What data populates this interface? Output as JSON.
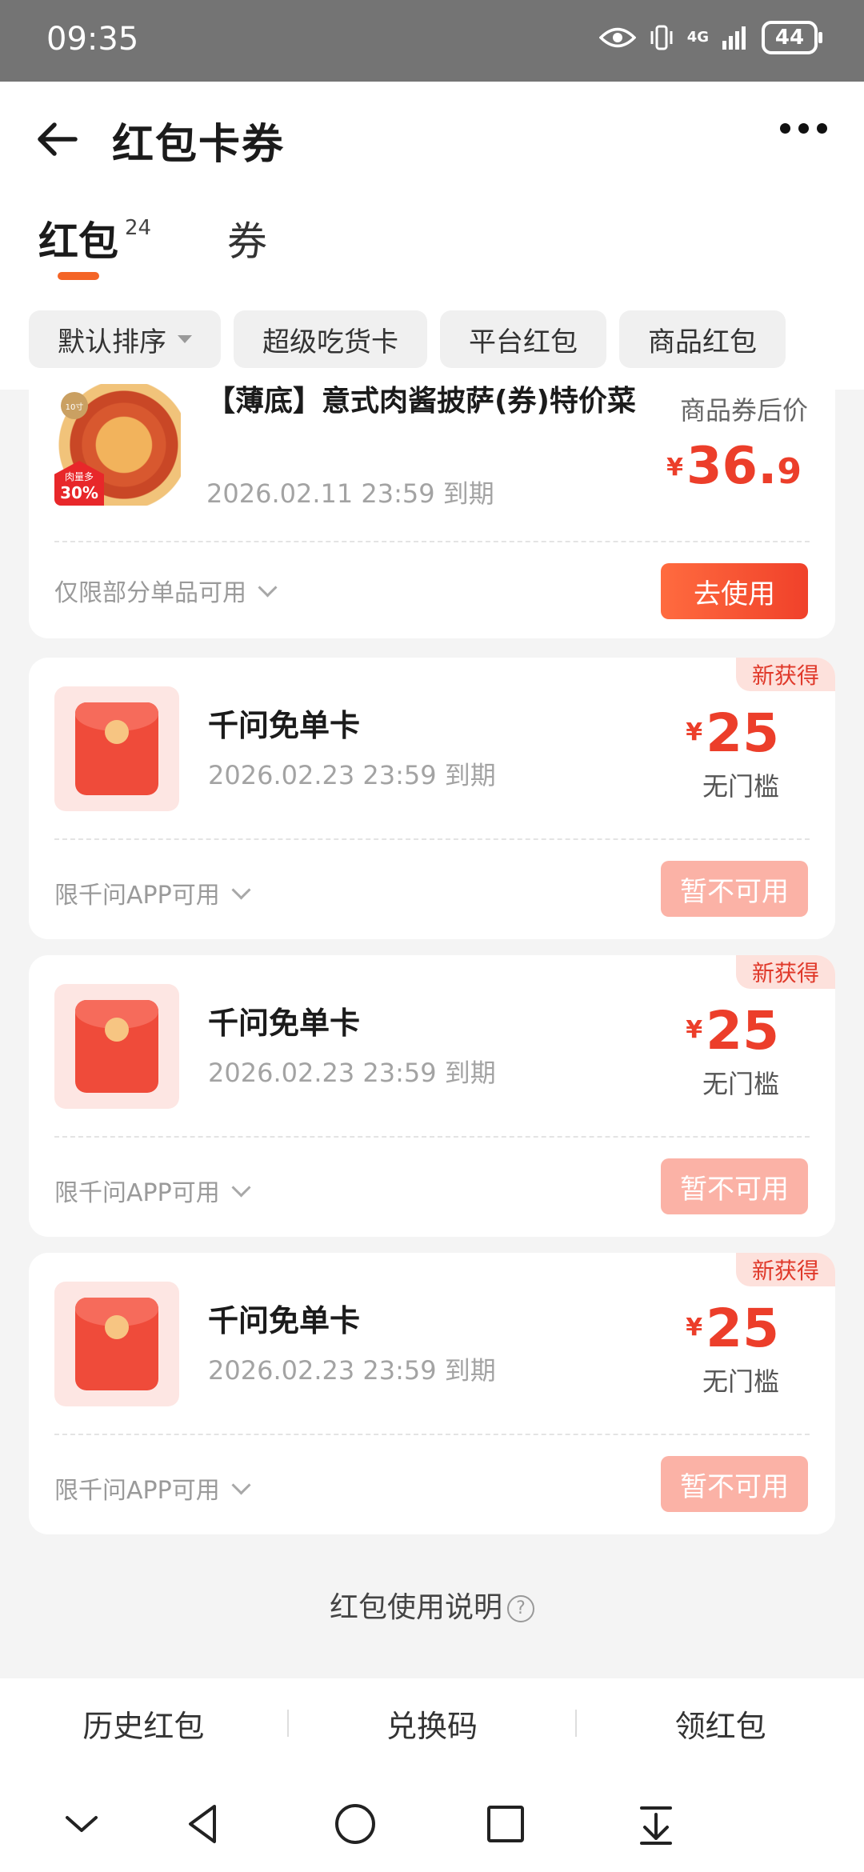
{
  "status_bar": {
    "time": "09:35",
    "network": "4G",
    "battery": "44"
  },
  "header": {
    "title": "红包卡券"
  },
  "tabs": [
    {
      "label": "红包",
      "count": "24",
      "active": true
    },
    {
      "label": "券",
      "active": false
    }
  ],
  "filters": [
    {
      "label": "默认排序",
      "dropdown": true
    },
    {
      "label": "超级吃货卡"
    },
    {
      "label": "平台红包"
    },
    {
      "label": "商品红包"
    }
  ],
  "product_coupon": {
    "title": "【薄底】意式肉酱披萨(券)特价菜",
    "expiry": "2026.02.11 23:59 到期",
    "price_label": "商品券后价",
    "currency": "¥",
    "price_int": "36.",
    "price_dec": "9",
    "thumb_badge": "10寸",
    "thumb_tag_small": "肉量多",
    "thumb_tag_big": "30%",
    "scope": "仅限部分单品可用",
    "action": "去使用"
  },
  "red_packets": [
    {
      "badge": "新获得",
      "name": "千问免单卡",
      "expiry": "2026.02.23 23:59 到期",
      "currency": "¥",
      "amount": "25",
      "threshold": "无门槛",
      "scope": "限千问APP可用",
      "action": "暂不可用"
    },
    {
      "badge": "新获得",
      "name": "千问免单卡",
      "expiry": "2026.02.23 23:59 到期",
      "currency": "¥",
      "amount": "25",
      "threshold": "无门槛",
      "scope": "限千问APP可用",
      "action": "暂不可用"
    },
    {
      "badge": "新获得",
      "name": "千问免单卡",
      "expiry": "2026.02.23 23:59 到期",
      "currency": "¥",
      "amount": "25",
      "threshold": "无门槛",
      "scope": "限千问APP可用",
      "action": "暂不可用"
    }
  ],
  "help": {
    "label": "红包使用说明",
    "icon": "?"
  },
  "bottom_actions": [
    "历史红包",
    "兑换码",
    "领红包"
  ],
  "colors": {
    "accent": "#f46426",
    "price": "#ec3e2a",
    "disabled_button": "#fbb2a6"
  },
  "nav_icons": [
    "chevron-down-icon",
    "back-triangle-icon",
    "home-circle-icon",
    "recents-square-icon",
    "download-icon"
  ]
}
